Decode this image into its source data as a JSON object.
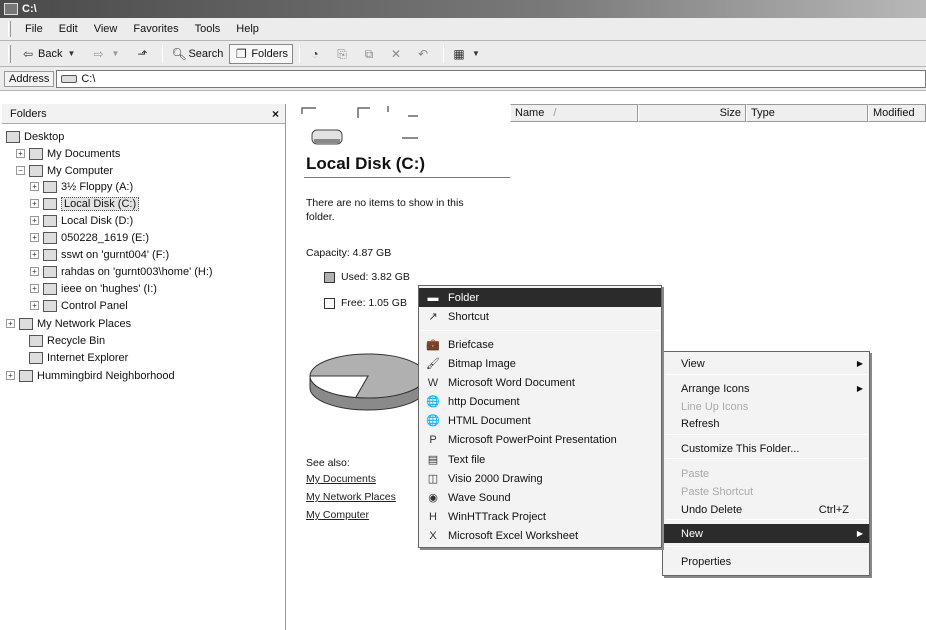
{
  "window": {
    "title": "C:\\"
  },
  "menubar": [
    "File",
    "Edit",
    "View",
    "Favorites",
    "Tools",
    "Help"
  ],
  "toolbar": {
    "back": "Back",
    "search": "Search",
    "folders": "Folders"
  },
  "address": {
    "label": "Address",
    "value": "C:\\"
  },
  "folders_pane": {
    "title": "Folders",
    "close": "×",
    "tree": [
      {
        "label": "Desktop",
        "icon": "desktop-icon",
        "expander": ""
      },
      {
        "label": "My Documents",
        "icon": "my-documents-icon",
        "expander": "+"
      },
      {
        "label": "My Computer",
        "icon": "my-computer-icon",
        "expander": "−"
      },
      {
        "label": "3½ Floppy (A:)",
        "icon": "floppy-drive-icon",
        "expander": "+"
      },
      {
        "label": "Local Disk (C:)",
        "icon": "hard-drive-icon",
        "expander": "+"
      },
      {
        "label": "Local Disk (D:)",
        "icon": "hard-drive-icon",
        "expander": "+"
      },
      {
        "label": "050228_1619 (E:)",
        "icon": "cd-drive-icon",
        "expander": "+"
      },
      {
        "label": "sswt on 'gurnt004' (F:)",
        "icon": "network-drive-icon",
        "expander": "+"
      },
      {
        "label": "rahdas on 'gurnt003\\home' (H:)",
        "icon": "network-drive-icon",
        "expander": "+"
      },
      {
        "label": "ieee on 'hughes' (I:)",
        "icon": "network-drive-icon",
        "expander": "+"
      },
      {
        "label": "Control Panel",
        "icon": "control-panel-icon",
        "expander": "+"
      },
      {
        "label": "My Network Places",
        "icon": "network-places-icon",
        "expander": "+"
      },
      {
        "label": "Recycle Bin",
        "icon": "recycle-bin-icon",
        "expander": ""
      },
      {
        "label": "Internet Explorer",
        "icon": "internet-explorer-icon",
        "expander": ""
      },
      {
        "label": "Hummingbird Neighborhood",
        "icon": "hummingbird-icon",
        "expander": "+"
      }
    ]
  },
  "columns": {
    "name": "Name",
    "sort_glyph": "/",
    "size": "Size",
    "type": "Type",
    "modified": "Modified"
  },
  "info_panel": {
    "title": "Local Disk (C:)",
    "empty_line1": "There are no items to show in this",
    "empty_line2": "folder.",
    "capacity": "Capacity: 4.87 GB",
    "used": "Used: 3.82 GB",
    "free": "Free: 1.05 GB",
    "used_fraction": 0.784,
    "see_also": "See also:",
    "links": [
      "My Documents",
      "My Network Places",
      "My Computer"
    ]
  },
  "context_menu": {
    "items": [
      {
        "label": "View",
        "submenu": true
      },
      {
        "label": "Arrange Icons",
        "submenu": true
      },
      {
        "label": "Line Up Icons",
        "disabled": true
      },
      {
        "label": "Refresh"
      },
      {
        "label": "Customize This Folder..."
      },
      {
        "label": "Paste",
        "disabled": true
      },
      {
        "label": "Paste Shortcut",
        "disabled": true
      },
      {
        "label": "Undo Delete",
        "shortcut": "Ctrl+Z"
      },
      {
        "label": "New",
        "submenu": true,
        "highlighted": true
      },
      {
        "label": "Properties"
      }
    ]
  },
  "new_submenu": {
    "items": [
      {
        "label": "Folder",
        "icon": "folder-icon",
        "highlighted": true
      },
      {
        "label": "Shortcut",
        "icon": "shortcut-icon"
      },
      {
        "label": "Briefcase",
        "icon": "briefcase-icon"
      },
      {
        "label": "Bitmap Image",
        "icon": "bitmap-icon"
      },
      {
        "label": "Microsoft Word Document",
        "icon": "word-document-icon"
      },
      {
        "label": "http Document",
        "icon": "http-document-icon"
      },
      {
        "label": "HTML Document",
        "icon": "html-document-icon"
      },
      {
        "label": "Microsoft PowerPoint Presentation",
        "icon": "powerpoint-icon"
      },
      {
        "label": "Text file",
        "icon": "text-file-icon"
      },
      {
        "label": "Visio 2000 Drawing",
        "icon": "visio-icon"
      },
      {
        "label": "Wave Sound",
        "icon": "wave-sound-icon"
      },
      {
        "label": "WinHTTrack Project",
        "icon": "winhttrack-icon"
      },
      {
        "label": "Microsoft Excel Worksheet",
        "icon": "excel-icon"
      }
    ]
  },
  "colors": {
    "highlight": "#2b2b2b",
    "menu_bg": "#f3f3f3",
    "chrome": "#ececec",
    "used_swatch": "#b0b0b0",
    "free_swatch": "#ffffff"
  }
}
